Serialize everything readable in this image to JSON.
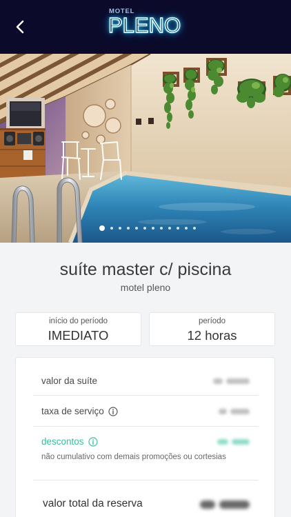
{
  "header": {
    "back_icon": "chevron-left-icon",
    "logo_small": "MOTEL",
    "logo_main": "PLENO",
    "background": "#0b0a2b",
    "logo_glow": "#38d9ff"
  },
  "gallery": {
    "image": "suite-pool-photo",
    "slide_count": 12,
    "active_slide": 1
  },
  "suite": {
    "name": "suíte master c/ piscina",
    "motel": "motel pleno"
  },
  "period_boxes": [
    {
      "label": "início do período",
      "value": "IMEDIATO"
    },
    {
      "label": "período",
      "value": "12 horas"
    }
  ],
  "pricing": {
    "suite_value_label": "valor da suíte",
    "service_fee_label": "taxa de serviço",
    "discounts_label": "descontos",
    "discounts_note": "não cumulativo com demais promoções ou cortesias",
    "total_label": "valor total da reserva",
    "info_icon": "info-icon",
    "discount_color": "#34c09e"
  },
  "colors": {
    "page_background": "#f3f4f6",
    "text": "#3b3b3b"
  }
}
